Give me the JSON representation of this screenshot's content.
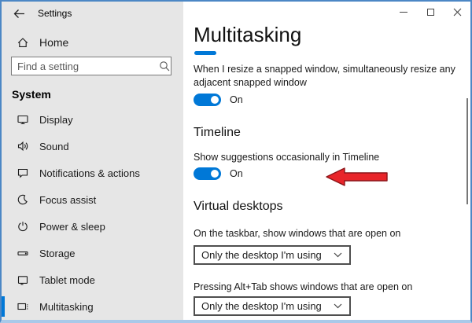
{
  "window": {
    "title": "Settings"
  },
  "sidebar": {
    "home_label": "Home",
    "search_placeholder": "Find a setting",
    "section_label": "System",
    "items": [
      {
        "label": "Display",
        "icon": "display-monitor",
        "selected": false
      },
      {
        "label": "Sound",
        "icon": "speaker",
        "selected": false
      },
      {
        "label": "Notifications & actions",
        "icon": "speech-bubble",
        "selected": false
      },
      {
        "label": "Focus assist",
        "icon": "crescent-moon",
        "selected": false
      },
      {
        "label": "Power & sleep",
        "icon": "power-symbol",
        "selected": false
      },
      {
        "label": "Storage",
        "icon": "drive",
        "selected": false
      },
      {
        "label": "Tablet mode",
        "icon": "tablet",
        "selected": false
      },
      {
        "label": "Multitasking",
        "icon": "multitask-windows",
        "selected": true
      }
    ]
  },
  "main": {
    "page_title": "Multitasking",
    "snap_setting": {
      "label": "When I resize a snapped window, simultaneously resize any adjacent snapped window",
      "toggle_state": "On"
    },
    "timeline": {
      "heading": "Timeline",
      "suggestion_label": "Show suggestions occasionally in Timeline",
      "toggle_state": "On"
    },
    "virtual_desktops": {
      "heading": "Virtual desktops",
      "taskbar_label": "On the taskbar, show windows that are open on",
      "taskbar_value": "Only the desktop I'm using",
      "alt_tab_label": "Pressing Alt+Tab shows windows that are open on",
      "alt_tab_value": "Only the desktop I'm using"
    }
  },
  "annotations": {
    "red_arrow": "points-left-at-timeline-toggle"
  },
  "colors": {
    "accent_blue": "#0078d7",
    "sidebar_gray": "#e6e6e6",
    "window_border_blue": "#4c87c5",
    "arrow_red": "#e8252a"
  }
}
